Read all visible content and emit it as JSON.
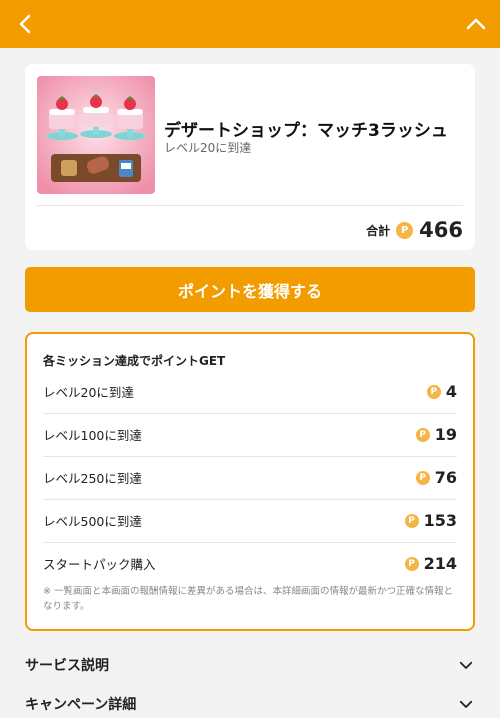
{
  "header": {
    "back_icon": "chevron-left-icon",
    "collapse_icon": "chevron-up-icon",
    "bar_color": "#f39c00"
  },
  "offer": {
    "title": "デザートショップ：マッチ3ラッシュ",
    "subtitle": "レベル20に到達",
    "total_label": "合計",
    "total_points": "466",
    "coin_symbol": "P"
  },
  "cta": {
    "label": "ポイントを獲得する"
  },
  "missions": {
    "heading": "各ミッション達成でポイントGET",
    "items": [
      {
        "label": "レベル20に到達",
        "points": "4"
      },
      {
        "label": "レベル100に到達",
        "points": "19"
      },
      {
        "label": "レベル250に到達",
        "points": "76"
      },
      {
        "label": "レベル500に到達",
        "points": "153"
      },
      {
        "label": "スタートパック購入",
        "points": "214"
      }
    ],
    "note": "※ 一覧画面と本画面の報酬情報に差異がある場合は、本詳細画面の情報が最新かつ正確な情報となります。"
  },
  "sections": [
    {
      "label": "サービス説明"
    },
    {
      "label": "キャンペーン詳細"
    }
  ],
  "colors": {
    "accent": "#f39c00",
    "coin": "#f5b544",
    "background": "#f3f3f3"
  }
}
